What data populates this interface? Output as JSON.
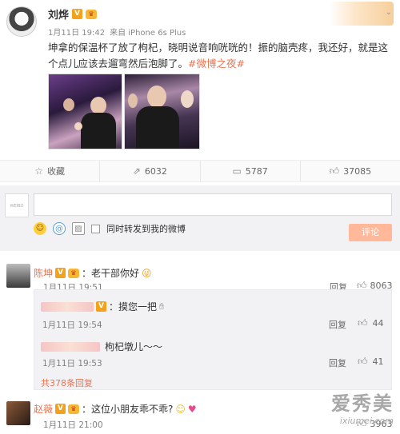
{
  "post": {
    "author": "刘烨",
    "meta_time": "1月11日 19:42",
    "meta_source": "来自 iPhone 6s Plus",
    "text_main": "坤拿的保温杯了放了枸杞，晓明说音响咣咣的！振的脑壳疼，我还好，就是这个点儿应该去遛弯然后泡脚了。",
    "hashtag": "#微博之夜#"
  },
  "actions": {
    "favorite": "收藏",
    "repost": "6032",
    "comment": "5787",
    "like": "37085"
  },
  "composer": {
    "sync_label": "同时转发到我的微博",
    "submit": "评论",
    "avatar_text": "WEIBO"
  },
  "comments": [
    {
      "name": "陈坤",
      "text": "：老干部你好",
      "time": "1月11日 19:51",
      "reply_label": "回复",
      "likes": "8063",
      "replies": [
        {
          "text": "：摸您一把",
          "time": "1月11日 19:54",
          "reply_label": "回复",
          "likes": "44"
        },
        {
          "text": "枸杞墩儿～～",
          "time": "1月11日 19:53",
          "reply_label": "回复",
          "likes": "41"
        }
      ],
      "more_replies": "共378条回复"
    },
    {
      "name": "赵薇",
      "text": "：这位小朋友乖不乖?",
      "time": "1月11日 21:00",
      "reply_label": "回复",
      "likes": "3963"
    }
  ],
  "watermark": {
    "big": "爱秀美",
    "small": "ixiumei.com"
  },
  "colors": {
    "accent": "#eb7350",
    "button": "#ffb99a"
  }
}
